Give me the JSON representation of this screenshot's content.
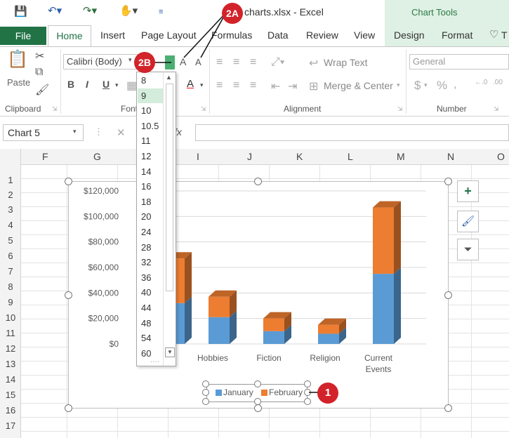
{
  "window": {
    "title": "charts.xlsx - Excel",
    "context_title": "Chart Tools"
  },
  "tabs": {
    "file": "File",
    "home": "Home",
    "insert": "Insert",
    "page_layout": "Page Layout",
    "formulas": "Formulas",
    "data": "Data",
    "review": "Review",
    "view": "View",
    "design": "Design",
    "format": "Format",
    "tell": "T"
  },
  "ribbon": {
    "paste": "Paste",
    "clipboard": "Clipboard",
    "font_group": "Font",
    "font_name": "Calibri (Body)",
    "bold": "B",
    "italic": "I",
    "underline": "U",
    "grow": "A",
    "shrink": "A",
    "wrap_text": "Wrap Text",
    "merge_center": "Merge & Center",
    "alignment": "Alignment",
    "number_format": "General",
    "number": "Number",
    "dollar": "$",
    "percent": "%",
    "font_color": "A"
  },
  "formula_bar": {
    "name_box": "Chart 5",
    "cancel": "✕",
    "fx": "fx"
  },
  "columns": [
    "F",
    "G",
    "H",
    "I",
    "J",
    "K",
    "L",
    "M",
    "N",
    "O"
  ],
  "rows": [
    "1",
    "2",
    "3",
    "4",
    "5",
    "6",
    "7",
    "8",
    "9",
    "10",
    "11",
    "12",
    "13",
    "14",
    "15",
    "16",
    "17"
  ],
  "font_sizes": [
    "8",
    "9",
    "10",
    "10.5",
    "11",
    "12",
    "14",
    "16",
    "18",
    "20",
    "24",
    "28",
    "32",
    "36",
    "40",
    "44",
    "48",
    "54",
    "60"
  ],
  "font_size_selected": "9",
  "callouts": {
    "a": "2A",
    "b": "2B",
    "c": "1"
  },
  "chart_data": {
    "type": "bar",
    "stacked": true,
    "three_d": true,
    "categories": [
      "",
      "Hobbies",
      "Fiction",
      "Religion",
      "Current\nEvents"
    ],
    "category_labels": [
      "Hobbies",
      "Fiction",
      "Religion",
      "Current",
      "Events"
    ],
    "series": [
      {
        "name": "January",
        "color": "#5b9bd5",
        "values": [
          32000,
          21000,
          10000,
          8000,
          55000
        ]
      },
      {
        "name": "February",
        "color": "#ed7d31",
        "values": [
          35000,
          16000,
          10000,
          7000,
          52000
        ]
      }
    ],
    "yticks": [
      "$120,000",
      "$100,000",
      "$80,000",
      "$60,000",
      "$40,000",
      "$20,000",
      "$0"
    ],
    "ylim": [
      0,
      120000
    ],
    "legend_position": "bottom"
  },
  "colors": {
    "accent": "#217346",
    "callout": "#d2232a"
  }
}
